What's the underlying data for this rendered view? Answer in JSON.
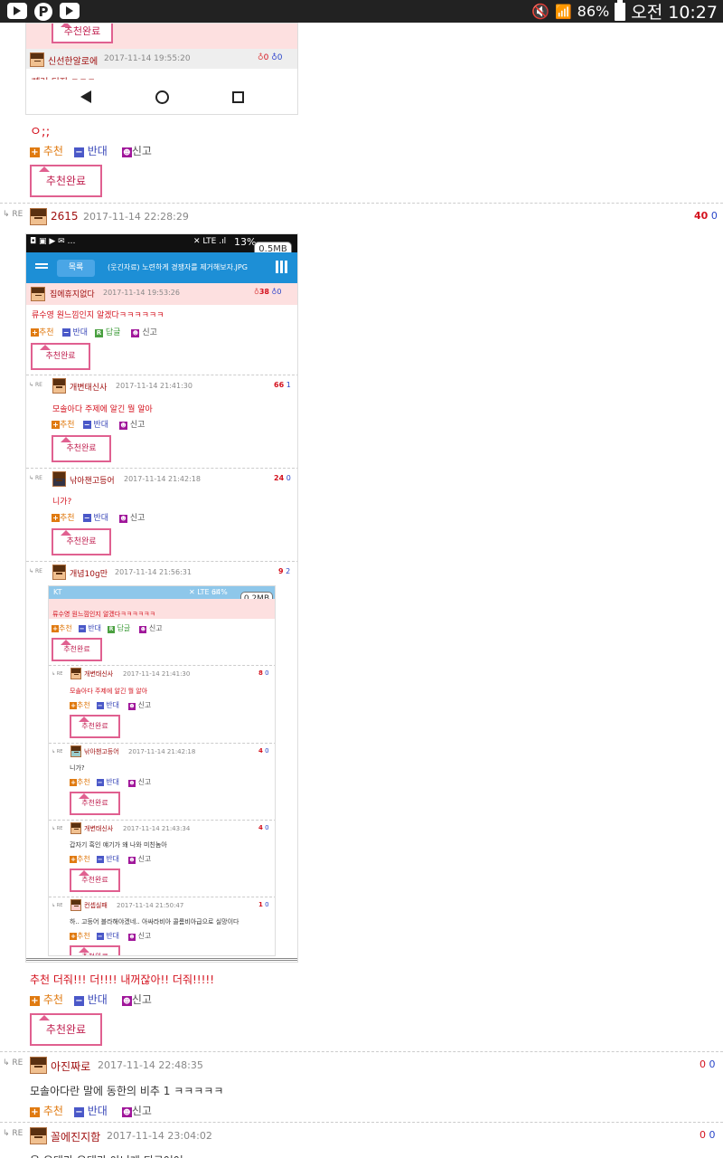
{
  "status_bar": {
    "battery": "86%",
    "time": "오전 10:27"
  },
  "labels": {
    "recommend": "추천",
    "oppose": "반대",
    "reply": "답글",
    "report": "신고",
    "recommend_done": "추천완료",
    "re": "RE"
  },
  "top_embed": {
    "nick": "신선한알로에",
    "date": "2017-11-14 19:55:20",
    "up": "0",
    "down": "0",
    "cut_text": "빼러 디지 ㅋㅋㅋ"
  },
  "first_comment_text": "ㅇ;;",
  "comment_2615": {
    "nick": "2615",
    "date": "2017-11-14 22:28:29",
    "up": "40",
    "down": "0",
    "text": "추천 더줘!!! 더!!!! 내꺼잖아!! 더줘!!!!!"
  },
  "shot1": {
    "size": "0.5MB",
    "battery": "13%",
    "tab": "목록",
    "title": "(웃긴자료) 노련하게 경쟁자를 제거해보자.JPG",
    "post": {
      "nick": "집에휴지없다",
      "date": "2017-11-14 19:53:26",
      "up": "38",
      "down": "0",
      "text": "류수영 원느낌인지 알겠다ㅋㅋㅋㅋㅋㅋ"
    },
    "replies": [
      {
        "nick": "개변태신사",
        "date": "2017-11-14 21:41:30",
        "up": "66",
        "down": "1",
        "text": "모솔아다 주제에 알긴 뭘 알아"
      },
      {
        "nick": "낚아챈고등어",
        "date": "2017-11-14 21:42:18",
        "up": "24",
        "down": "0",
        "text": "니가?"
      },
      {
        "nick": "개념10g만",
        "date": "2017-11-14 21:56:31",
        "up": "9",
        "down": "2",
        "text": ""
      }
    ]
  },
  "shot2": {
    "size": "0.2MB",
    "carrier": "KT",
    "battery": "64%",
    "post_text": "류수영 원느낌인지 알겠다ㅋㅋㅋㅋㅋㅋ",
    "replies": [
      {
        "nick": "개변태신사",
        "date": "2017-11-14 21:41:30",
        "up": "8",
        "down": "0",
        "text": "모솔아다 주제에 알긴 뭘 알아"
      },
      {
        "nick": "낚아챈고등어",
        "date": "2017-11-14 21:42:18",
        "up": "4",
        "down": "0",
        "text": "니가?"
      },
      {
        "nick": "개변태신사",
        "date": "2017-11-14 21:43:34",
        "up": "4",
        "down": "0",
        "text": "갑자기 흑인 얘기가 왜 나와 미친놈아"
      },
      {
        "nick": "컨셉실패",
        "date": "2017-11-14 21:50:47",
        "up": "1",
        "down": "0",
        "text": "하.. 고등어 블라해야겠네.. 아싸라비아 콜롬비아급으로 실망이다"
      }
    ]
  },
  "comment_ajin": {
    "nick": "아진짜로",
    "date": "2017-11-14 22:48:35",
    "up": "0",
    "down": "0",
    "text": "모솔아다란 말에 동한의 비추 1 ㅋㅋㅋㅋㅋ"
  },
  "comment_last": {
    "nick": "꼴에진지함",
    "date": "2017-11-14 23:04:02",
    "up": "0",
    "down": "0",
    "text": "응 유태가 유태가 아니게 되구어어"
  }
}
